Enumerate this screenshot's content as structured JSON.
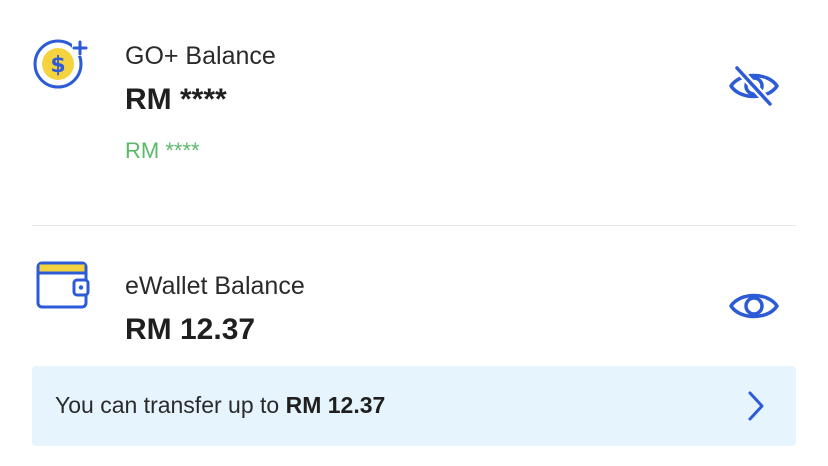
{
  "go_plus": {
    "label": "GO+ Balance",
    "amount": "RM ****",
    "sub_amount": "RM ****",
    "visibility_icon": "eye-off-icon"
  },
  "ewallet": {
    "label": "eWallet Balance",
    "amount": "RM 12.37",
    "visibility_icon": "eye-icon"
  },
  "transfer": {
    "prefix": "You can transfer up to",
    "amount": "RM 12.37",
    "icon": "chevron-right-icon"
  },
  "colors": {
    "accent_blue": "#2d5bd7",
    "icon_yellow": "#f5d33f",
    "positive_green": "#5cb96a",
    "banner_bg": "#e6f4fd"
  }
}
